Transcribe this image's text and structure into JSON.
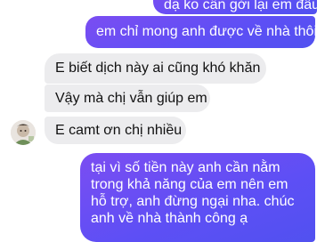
{
  "messages": [
    {
      "id": "out-1",
      "direction": "sent",
      "text": "dạ ko cần gởi lại em đâu ạ"
    },
    {
      "id": "out-2",
      "direction": "sent",
      "text": "em chỉ mong anh được về nhà thôi"
    },
    {
      "id": "in-1",
      "direction": "received",
      "text": "E biết dịch này ai cũng khó khăn"
    },
    {
      "id": "in-2",
      "direction": "received",
      "text": "Vậy mà chị vẫn giúp em"
    },
    {
      "id": "in-3",
      "direction": "received",
      "text": "E camt ơn chị nhiều"
    },
    {
      "id": "out-3",
      "direction": "sent",
      "text": "tại vì số tiền này anh cần nằm trong khả năng của em nên em hỗ trợ, anh đừng ngại nha. chúc anh về nhà thành công ạ"
    }
  ],
  "colors": {
    "sent_bubble": "#6a4cf4",
    "received_bubble": "#ececee",
    "sent_text": "#ffffff",
    "received_text": "#111111"
  },
  "icons": {
    "avatar": "contact-avatar"
  }
}
